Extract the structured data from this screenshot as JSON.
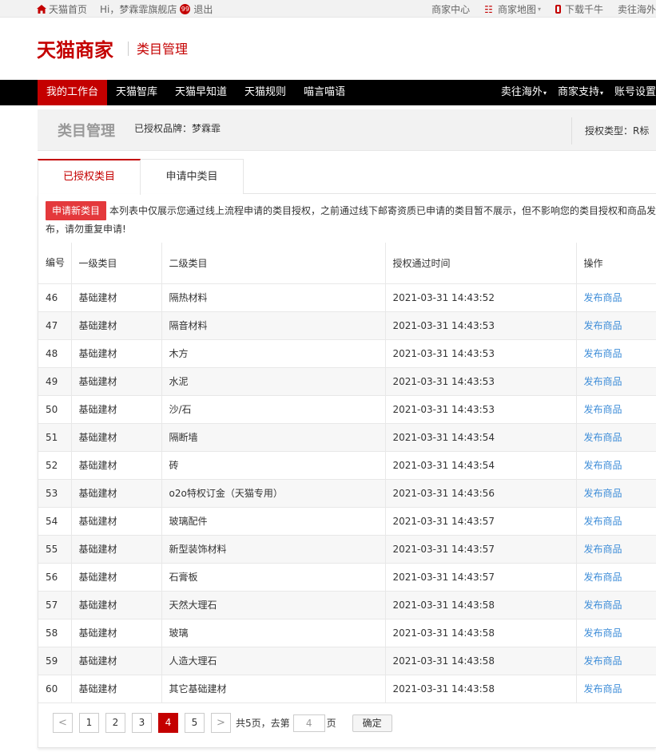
{
  "topbar": {
    "home": "天猫首页",
    "greeting": "Hi，梦霖霏旗舰店",
    "msg_badge": "99",
    "logout": "退出",
    "merchant_center": "商家中心",
    "merchant_map": "商家地图",
    "download": "下载千牛",
    "overseas": "卖往海外"
  },
  "header": {
    "logo": "天猫商家",
    "subtitle": "类目管理"
  },
  "nav": {
    "items": [
      "我的工作台",
      "天猫智库",
      "天猫早知道",
      "天猫规则",
      "喵言喵语"
    ],
    "right_items": [
      "卖往海外",
      "商家支持",
      "账号设置"
    ]
  },
  "titlebar": {
    "title": "类目管理",
    "brand": "已授权品牌：梦霖霏",
    "authtype": "授权类型：R标"
  },
  "tabs": {
    "active": "已授权类目",
    "inactive": "申请中类目"
  },
  "notice": {
    "button": "申请新类目",
    "text": "本列表中仅展示您通过线上流程申请的类目授权，之前通过线下邮寄资质已申请的类目暂不展示，但不影响您的类目授权和商品发布，请勿重复申请!"
  },
  "table": {
    "headers": [
      "编号",
      "一级类目",
      "二级类目",
      "授权通过时间",
      "操作"
    ],
    "rows": [
      {
        "id": "46",
        "cat1": "基础建材",
        "cat2": "隔热材料",
        "time": "2021-03-31 14:43:52",
        "op": "发布商品"
      },
      {
        "id": "47",
        "cat1": "基础建材",
        "cat2": "隔音材料",
        "time": "2021-03-31 14:43:53",
        "op": "发布商品"
      },
      {
        "id": "48",
        "cat1": "基础建材",
        "cat2": "木方",
        "time": "2021-03-31 14:43:53",
        "op": "发布商品"
      },
      {
        "id": "49",
        "cat1": "基础建材",
        "cat2": "水泥",
        "time": "2021-03-31 14:43:53",
        "op": "发布商品"
      },
      {
        "id": "50",
        "cat1": "基础建材",
        "cat2": "沙/石",
        "time": "2021-03-31 14:43:53",
        "op": "发布商品"
      },
      {
        "id": "51",
        "cat1": "基础建材",
        "cat2": "隔断墙",
        "time": "2021-03-31 14:43:54",
        "op": "发布商品"
      },
      {
        "id": "52",
        "cat1": "基础建材",
        "cat2": "砖",
        "time": "2021-03-31 14:43:54",
        "op": "发布商品"
      },
      {
        "id": "53",
        "cat1": "基础建材",
        "cat2": "o2o特权订金（天猫专用）",
        "time": "2021-03-31 14:43:56",
        "op": "发布商品"
      },
      {
        "id": "54",
        "cat1": "基础建材",
        "cat2": "玻璃配件",
        "time": "2021-03-31 14:43:57",
        "op": "发布商品"
      },
      {
        "id": "55",
        "cat1": "基础建材",
        "cat2": "新型装饰材料",
        "time": "2021-03-31 14:43:57",
        "op": "发布商品"
      },
      {
        "id": "56",
        "cat1": "基础建材",
        "cat2": "石膏板",
        "time": "2021-03-31 14:43:57",
        "op": "发布商品"
      },
      {
        "id": "57",
        "cat1": "基础建材",
        "cat2": "天然大理石",
        "time": "2021-03-31 14:43:58",
        "op": "发布商品"
      },
      {
        "id": "58",
        "cat1": "基础建材",
        "cat2": "玻璃",
        "time": "2021-03-31 14:43:58",
        "op": "发布商品"
      },
      {
        "id": "59",
        "cat1": "基础建材",
        "cat2": "人造大理石",
        "time": "2021-03-31 14:43:58",
        "op": "发布商品"
      },
      {
        "id": "60",
        "cat1": "基础建材",
        "cat2": "其它基础建材",
        "time": "2021-03-31 14:43:58",
        "op": "发布商品"
      }
    ]
  },
  "pager": {
    "prev": "<",
    "pages": [
      "1",
      "2",
      "3",
      "4",
      "5"
    ],
    "current": "4",
    "next": ">",
    "total_text": "共5页，去第",
    "input_value": "4",
    "page_suffix": "页",
    "confirm": "确定"
  },
  "colors": {
    "brand_red": "#c40000",
    "link_blue": "#3e8dd8"
  }
}
